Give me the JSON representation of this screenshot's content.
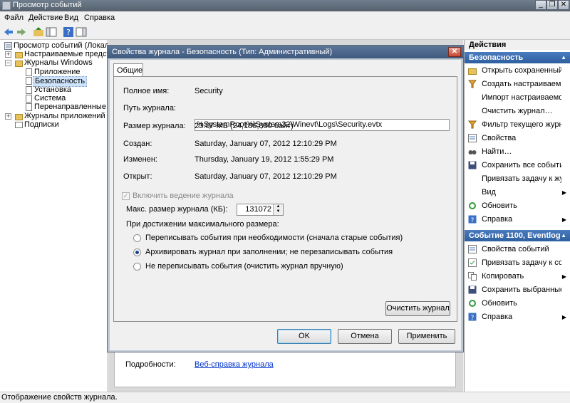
{
  "window": {
    "title": "Просмотр событий"
  },
  "menu": [
    "Файл",
    "Действие",
    "Вид",
    "Справка"
  ],
  "tree": {
    "root": "Просмотр событий (Локальный)",
    "custom_views": "Настраиваемые представлен…",
    "windows_logs": "Журналы Windows",
    "windows_children": [
      "Приложение",
      "Безопасность",
      "Установка",
      "Система",
      "Перенаправленные собы"
    ],
    "app_logs": "Журналы приложений и служ",
    "subscriptions": "Подписки"
  },
  "bottom_info": {
    "label": "Подробности:",
    "link": "Веб-справка журнала"
  },
  "statusbar": "Отображение свойств журнала.",
  "actions": {
    "title": "Действия",
    "section1": "Безопасность",
    "section1_items": [
      {
        "label": "Открыть сохраненный …",
        "icon": "folder-open-icon"
      },
      {
        "label": "Создать настраиваемо…",
        "icon": "filter-icon"
      },
      {
        "label": "Импорт настраиваемого…",
        "icon": "blank-icon"
      },
      {
        "label": "Очистить журнал…",
        "icon": "blank-icon"
      },
      {
        "label": "Фильтр текущего журн…",
        "icon": "filter-icon"
      },
      {
        "label": "Свойства",
        "icon": "properties-icon"
      },
      {
        "label": "Найти…",
        "icon": "binoculars-icon"
      },
      {
        "label": "Сохранить все события…",
        "icon": "save-icon"
      },
      {
        "label": "Привязать задачу к жу…",
        "icon": "blank-icon"
      },
      {
        "label": "Вид",
        "icon": "blank-icon",
        "submenu": true
      },
      {
        "label": "Обновить",
        "icon": "refresh-icon"
      },
      {
        "label": "Справка",
        "icon": "help-icon",
        "submenu": true
      }
    ],
    "section2": "Событие 1100, Eventlog",
    "section2_items": [
      {
        "label": "Свойства событий",
        "icon": "properties-icon"
      },
      {
        "label": "Привязать задачу к соб…",
        "icon": "task-icon"
      },
      {
        "label": "Копировать",
        "icon": "copy-icon",
        "submenu": true
      },
      {
        "label": "Сохранить выбранные …",
        "icon": "save-icon"
      },
      {
        "label": "Обновить",
        "icon": "refresh-icon"
      },
      {
        "label": "Справка",
        "icon": "help-icon",
        "submenu": true
      }
    ]
  },
  "dialog": {
    "title": "Свойства журнала - Безопасность (Тип: Административный)",
    "tab": "Общие",
    "full_name_label": "Полное имя:",
    "full_name": "Security",
    "path_label": "Путь журнала:",
    "path": "%SystemRoot%\\System32\\Winevt\\Logs\\Security.evtx",
    "size_label": "Размер журнала:",
    "size": "23.07 МБ (24,186,880 байт)",
    "created_label": "Создан:",
    "created": "Saturday, January 07, 2012 12:10:29 PM",
    "modified_label": "Изменен:",
    "modified": "Thursday, January 19, 2012 1:55:29 PM",
    "opened_label": "Открыт:",
    "opened": "Saturday, January 07, 2012 12:10:29 PM",
    "enable_logging": "Включить ведение журнала",
    "enable_logging_checked": true,
    "max_size_label": "Макс. размер журнала (КБ):",
    "max_size": "131072",
    "policy_label": "При достижении максимального размера:",
    "policy_options": [
      "Переписывать события при необходимости (сначала старые события)",
      "Архивировать журнал при заполнении; не перезаписывать события",
      "Не переписывать события (очистить журнал вручную)"
    ],
    "policy_selected": 1,
    "clear_button": "Очистить журнал",
    "ok_button": "OK",
    "cancel_button": "Отмена",
    "apply_button": "Применить"
  }
}
